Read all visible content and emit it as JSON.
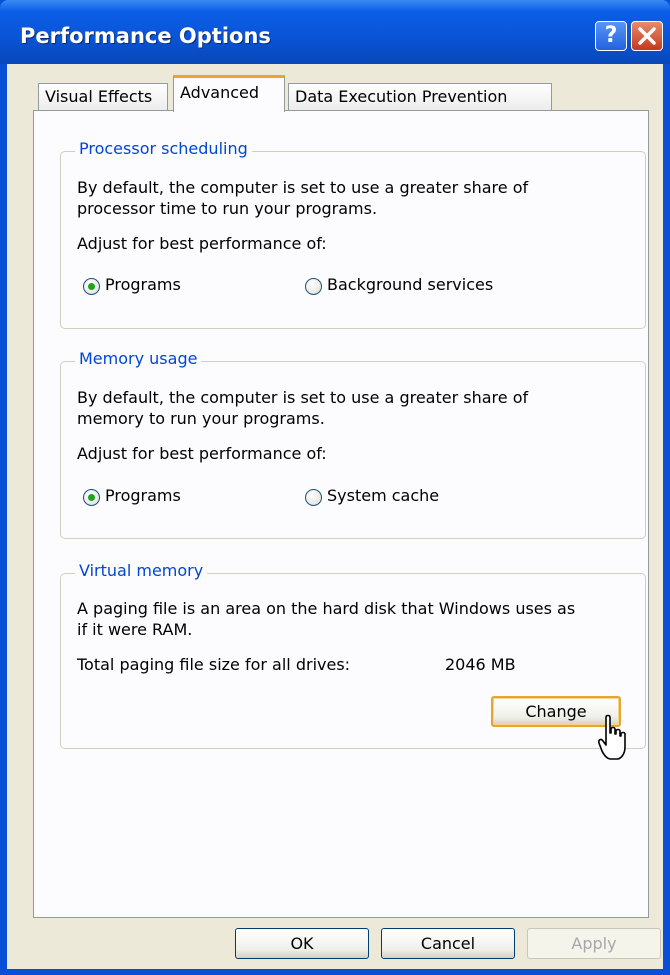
{
  "window": {
    "title": "Performance Options",
    "help_icon": "question-mark-icon",
    "close_icon": "close-x-icon"
  },
  "tabs": [
    {
      "label": "Visual Effects",
      "selected": false
    },
    {
      "label": "Advanced",
      "selected": true
    },
    {
      "label": "Data Execution Prevention",
      "selected": false
    }
  ],
  "processor": {
    "title": "Processor scheduling",
    "description_line1": "By default, the computer is set to use a greater share of",
    "description_line2": "processor time to run your programs.",
    "adjust_label": "Adjust for best performance of:",
    "option1": "Programs",
    "option2": "Background services",
    "selected": "Programs"
  },
  "memory": {
    "title": "Memory usage",
    "description_line1": "By default, the computer is set to use a greater share of",
    "description_line2": "memory to run your programs.",
    "adjust_label": "Adjust for best performance of:",
    "option1": "Programs",
    "option2": "System cache",
    "selected": "Programs"
  },
  "virtual_memory": {
    "title": "Virtual memory",
    "description_line1": "A paging file is an area on the hard disk that Windows uses as",
    "description_line2": "if it were RAM.",
    "total_label": "Total paging file size for all drives:",
    "total_value": "2046 MB",
    "change_label": "Change"
  },
  "buttons": {
    "ok": "OK",
    "cancel": "Cancel",
    "apply": "Apply"
  },
  "colors": {
    "titlebar": "#0a55d9",
    "group_title": "#0046d5",
    "focus_accent": "#e6a531",
    "radio_dot": "#21a121"
  }
}
